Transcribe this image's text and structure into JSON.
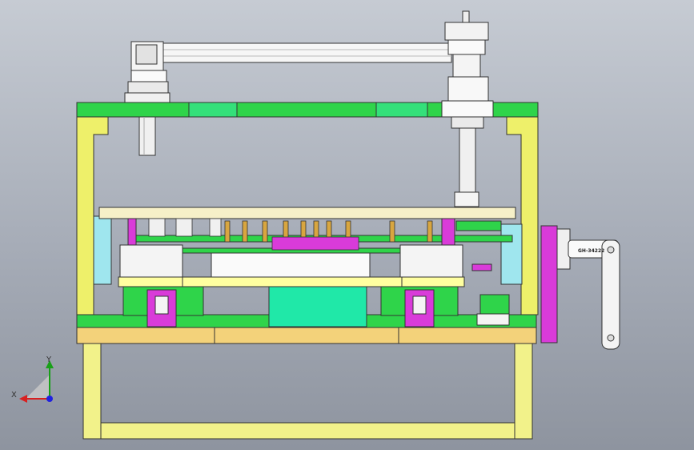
{
  "part_label": "GH-34222",
  "triad": {
    "x_label": "X",
    "y_label": "Y"
  },
  "colors": {
    "frame_green": "#2fd44a",
    "side_yellow": "#eef06a",
    "base_tan": "#f3d27a",
    "magenta": "#d93bd9",
    "teal": "#20e8a8",
    "light_yellow": "#ffffa0"
  }
}
